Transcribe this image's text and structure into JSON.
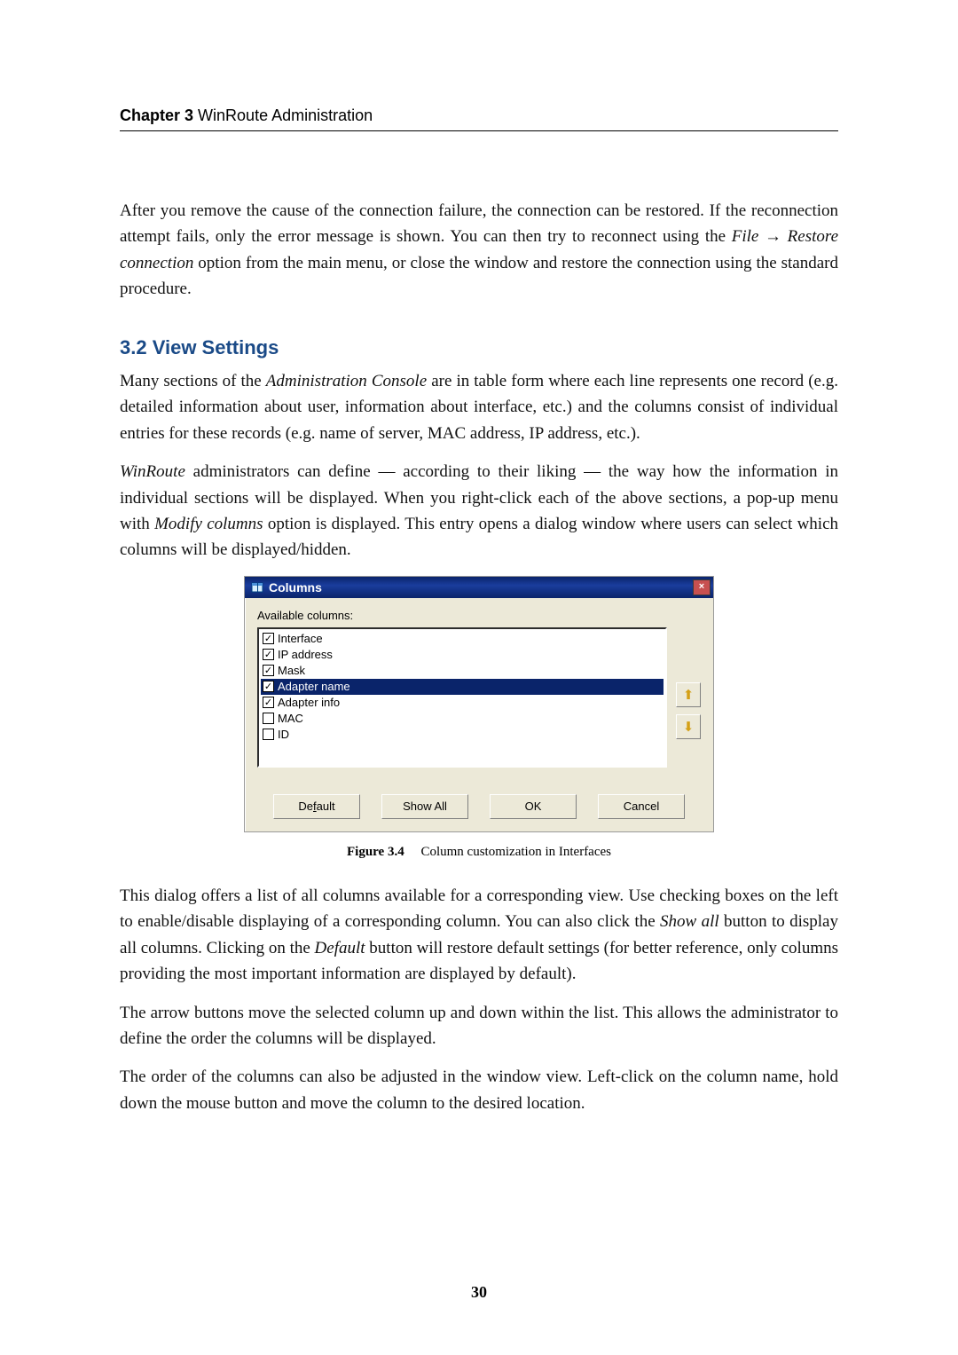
{
  "running_head": {
    "chapter": "Chapter 3",
    "title": "WinRoute Administration"
  },
  "para1": "After you remove the cause of the connection failure, the connection can be restored. If the reconnection attempt fails, only the error message is shown. You can then try to reconnect using the ",
  "para1_ital": "File → Restore connection",
  "para1_tail": " option from the main menu, or close the window and restore the connection using the standard procedure.",
  "section_heading": "3.2  View Settings",
  "para2a": "Many sections of the ",
  "para2a_ital": "Administration Console",
  "para2a_tail": " are in table form where each line represents one record (e.g. detailed information about user, information about interface, etc.) and the columns consist of individual entries for these records (e.g. name of server, MAC address, IP address, etc.).",
  "para2b_ital": "WinRoute",
  "para2b_mid": " administrators can define — according to their liking — the way how the information in individual sections will be displayed. When you right-click each of the above sections, a pop-up menu with ",
  "para2b_ital2": "Modify columns",
  "para2b_tail": " option is displayed. This entry opens a dialog window where users can select which columns will be displayed/hidden.",
  "dialog": {
    "title": "Columns",
    "close_x": "×",
    "available_label": "Available columns:",
    "items": [
      {
        "label": "Interface",
        "checked": true,
        "selected": false
      },
      {
        "label": "IP address",
        "checked": true,
        "selected": false
      },
      {
        "label": "Mask",
        "checked": true,
        "selected": false
      },
      {
        "label": "Adapter name",
        "checked": true,
        "selected": true
      },
      {
        "label": "Adapter info",
        "checked": true,
        "selected": false
      },
      {
        "label": "MAC",
        "checked": false,
        "selected": false
      },
      {
        "label": "ID",
        "checked": false,
        "selected": false
      }
    ],
    "arrow_up": "⬆",
    "arrow_down": "⬇",
    "btn_default_pre": "De",
    "btn_default_u": "f",
    "btn_default_post": "ault",
    "btn_showall": "Show All",
    "btn_ok": "OK",
    "btn_cancel": "Cancel"
  },
  "figure": {
    "num": "Figure 3.4",
    "text": "Column customization in Interfaces"
  },
  "para3a": "This dialog offers a list of all columns available for a corresponding view. Use checking boxes on the left to enable/disable displaying of a corresponding column. You can also click the ",
  "para3a_ital1": "Show all",
  "para3a_mid": " button to display all columns. Clicking on the ",
  "para3a_ital2": "Default",
  "para3a_tail": " button will restore default settings (for better reference, only columns providing the most important information are displayed by default).",
  "para4": "The arrow buttons move the selected column up and down within the list. This allows the administrator to define the order the columns will be displayed.",
  "para5": "The order of the columns can also be adjusted in the window view. Left-click on the column name, hold down the mouse button and move the column to the desired location.",
  "page_number": "30"
}
